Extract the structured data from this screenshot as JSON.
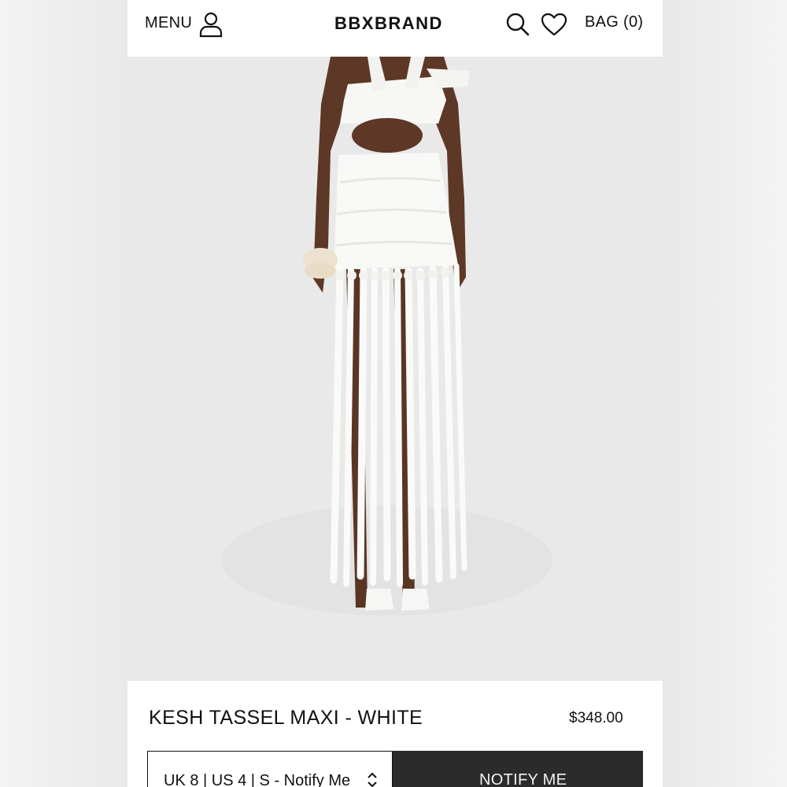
{
  "header": {
    "menu_label": "MENU",
    "brand": "BBXBRAND",
    "bag_label": "BAG (0)",
    "icons": [
      "user-icon",
      "search-icon",
      "heart-icon"
    ]
  },
  "product": {
    "title": "KESH TASSEL MAXI - WHITE",
    "price": "$348.00",
    "image_icon": "product-photo"
  },
  "purchase": {
    "size_selected": "UK 8 | US 4 | S - Notify Me",
    "notify_button": "NOTIFY ME"
  },
  "colors": {
    "brand_text": "#111111",
    "image_background": "#e9e9e9",
    "button_background": "#2b2b2b"
  }
}
